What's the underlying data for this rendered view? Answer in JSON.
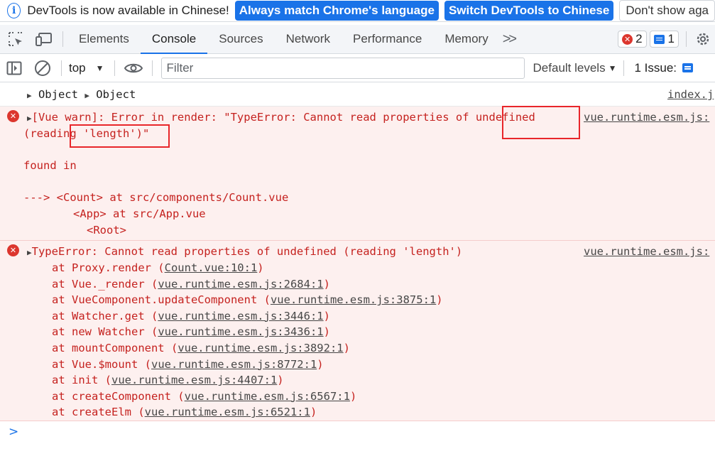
{
  "infobar": {
    "message": "DevTools is now available in Chinese!",
    "match_button": "Always match Chrome's language",
    "switch_button": "Switch DevTools to Chinese",
    "dismiss_button": "Don't show aga"
  },
  "tabs": {
    "elements": "Elements",
    "console": "Console",
    "sources": "Sources",
    "network": "Network",
    "performance": "Performance",
    "memory": "Memory",
    "more": ">>"
  },
  "counters": {
    "errors": "2",
    "messages": "1"
  },
  "toolbar": {
    "context": "top",
    "filter_placeholder": "Filter",
    "levels": "Default levels",
    "issues": "1 Issue:"
  },
  "console": {
    "log": {
      "obj1": "Object",
      "obj2": "Object",
      "source": "index.j"
    },
    "warn": {
      "line1": "[Vue warn]: Error in render: \"TypeError: Cannot read properties of undefined",
      "line2": "(reading 'length')\"",
      "source": "vue.runtime.esm.js:",
      "found": "found in",
      "trace1": "---> <Count> at src/components/Count.vue",
      "trace2": "<App> at src/App.vue",
      "trace3": "<Root>"
    },
    "error": {
      "message": "TypeError: Cannot read properties of undefined (reading 'length')",
      "source": "vue.runtime.esm.js:",
      "stack": [
        {
          "fn": "at Proxy.render (",
          "loc": "Count.vue:10:1",
          "end": ")"
        },
        {
          "fn": "at Vue._render (",
          "loc": "vue.runtime.esm.js:2684:1",
          "end": ")"
        },
        {
          "fn": "at VueComponent.updateComponent (",
          "loc": "vue.runtime.esm.js:3875:1",
          "end": ")"
        },
        {
          "fn": "at Watcher.get (",
          "loc": "vue.runtime.esm.js:3446:1",
          "end": ")"
        },
        {
          "fn": "at new Watcher (",
          "loc": "vue.runtime.esm.js:3436:1",
          "end": ")"
        },
        {
          "fn": "at mountComponent (",
          "loc": "vue.runtime.esm.js:3892:1",
          "end": ")"
        },
        {
          "fn": "at Vue.$mount (",
          "loc": "vue.runtime.esm.js:8772:1",
          "end": ")"
        },
        {
          "fn": "at init (",
          "loc": "vue.runtime.esm.js:4407:1",
          "end": ")"
        },
        {
          "fn": "at createComponent (",
          "loc": "vue.runtime.esm.js:6567:1",
          "end": ")"
        },
        {
          "fn": "at createElm (",
          "loc": "vue.runtime.esm.js:6521:1",
          "end": ")"
        }
      ]
    },
    "prompt": ">"
  }
}
